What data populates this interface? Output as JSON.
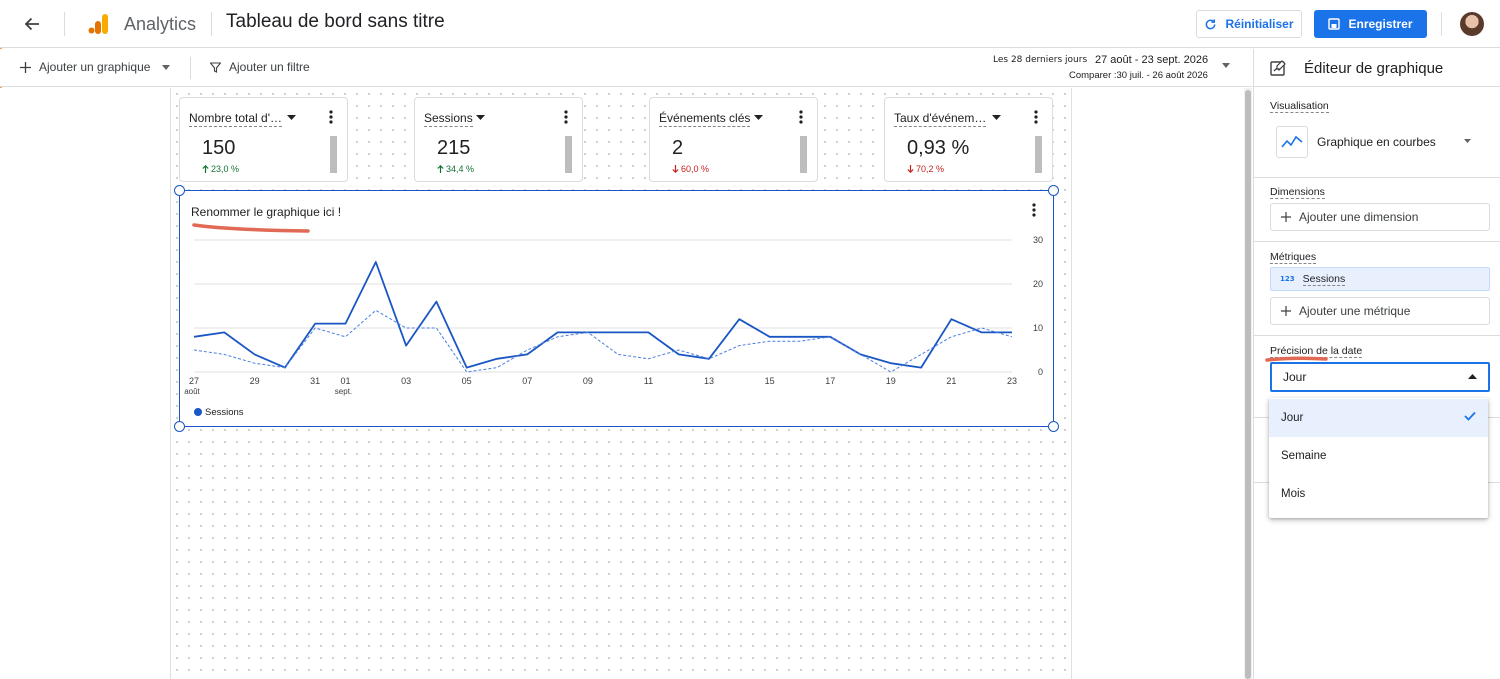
{
  "header": {
    "app_name": "Analytics",
    "report_title": "Tableau de bord sans titre",
    "reset_label": "Réinitialiser",
    "save_label": "Enregistrer"
  },
  "toolbar": {
    "add_chart_label": "Ajouter un graphique",
    "add_filter_label": "Ajouter un filtre",
    "date_preset": "Les 28 derniers jours",
    "date_range": "27 août - 23 sept. 2026",
    "compare_range": "Comparer :30 juil. - 26 août 2026"
  },
  "scorecards": [
    {
      "title": "Nombre total d'…",
      "value": "150",
      "delta": "23,0 %",
      "direction": "up"
    },
    {
      "title": "Sessions",
      "value": "215",
      "delta": "34,4 %",
      "direction": "up"
    },
    {
      "title": "Événements clés",
      "value": "2",
      "delta": "60,0 %",
      "direction": "down"
    },
    {
      "title": "Taux d'événem…",
      "value": "0,93 %",
      "delta": "70,2 %",
      "direction": "down"
    }
  ],
  "chart": {
    "title": "Renommer le graphique ici !",
    "legend": "Sessions"
  },
  "chart_data": {
    "type": "line",
    "x": [
      "27 août",
      "28",
      "29",
      "30",
      "31",
      "01 sept.",
      "02",
      "03",
      "04",
      "05",
      "06",
      "07",
      "08",
      "09",
      "10",
      "11",
      "12",
      "13",
      "14",
      "15",
      "16",
      "17",
      "18",
      "19",
      "20",
      "21",
      "22",
      "23"
    ],
    "x_ticks": [
      {
        "index": 0,
        "label": "27",
        "sub": "août"
      },
      {
        "index": 2,
        "label": "29",
        "sub": ""
      },
      {
        "index": 4,
        "label": "31",
        "sub": ""
      },
      {
        "index": 5,
        "label": "01",
        "sub": "sept."
      },
      {
        "index": 7,
        "label": "03",
        "sub": ""
      },
      {
        "index": 9,
        "label": "05",
        "sub": ""
      },
      {
        "index": 11,
        "label": "07",
        "sub": ""
      },
      {
        "index": 13,
        "label": "09",
        "sub": ""
      },
      {
        "index": 15,
        "label": "11",
        "sub": ""
      },
      {
        "index": 17,
        "label": "13",
        "sub": ""
      },
      {
        "index": 19,
        "label": "15",
        "sub": ""
      },
      {
        "index": 21,
        "label": "17",
        "sub": ""
      },
      {
        "index": 23,
        "label": "19",
        "sub": ""
      },
      {
        "index": 25,
        "label": "21",
        "sub": ""
      },
      {
        "index": 27,
        "label": "23",
        "sub": ""
      }
    ],
    "y_ticks": [
      "0",
      "10",
      "20",
      "30"
    ],
    "ylim": [
      0,
      30
    ],
    "series": [
      {
        "name": "Sessions",
        "style": "solid",
        "color": "#1a56c4",
        "values": [
          8,
          9,
          4,
          1,
          11,
          11,
          25,
          6,
          16,
          1,
          3,
          4,
          9,
          9,
          9,
          9,
          4,
          3,
          12,
          8,
          8,
          8,
          4,
          2,
          1,
          12,
          9,
          9
        ]
      },
      {
        "style": "dashed",
        "color": "#4a7fe0",
        "values": [
          5,
          4,
          2,
          1,
          10,
          8,
          14,
          10,
          10,
          0,
          1,
          5,
          8,
          9,
          4,
          3,
          5,
          3,
          6,
          7,
          7,
          8,
          4,
          0,
          4,
          8,
          10,
          8
        ]
      }
    ],
    "grid": true,
    "legend_position": "bottom-left"
  },
  "panel": {
    "title": "Éditeur de graphique",
    "visualization_label": "Visualisation",
    "visualization_value": "Graphique en courbes",
    "dimensions_label": "Dimensions",
    "add_dimension_label": "Ajouter une dimension",
    "metrics_label": "Métriques",
    "metric_chip_icon": "123",
    "metric_chip_label": "Sessions",
    "add_metric_label": "Ajouter une métrique",
    "date_precision_label": "Précision de la date",
    "date_precision_value": "Jour",
    "options": [
      "Jour",
      "Semaine",
      "Mois"
    ]
  },
  "colors": {
    "accent": "#1a73e8",
    "chart_line": "#1a56c4",
    "annotation": "#e06a55",
    "positive": "#137333",
    "negative": "#c5221f"
  }
}
